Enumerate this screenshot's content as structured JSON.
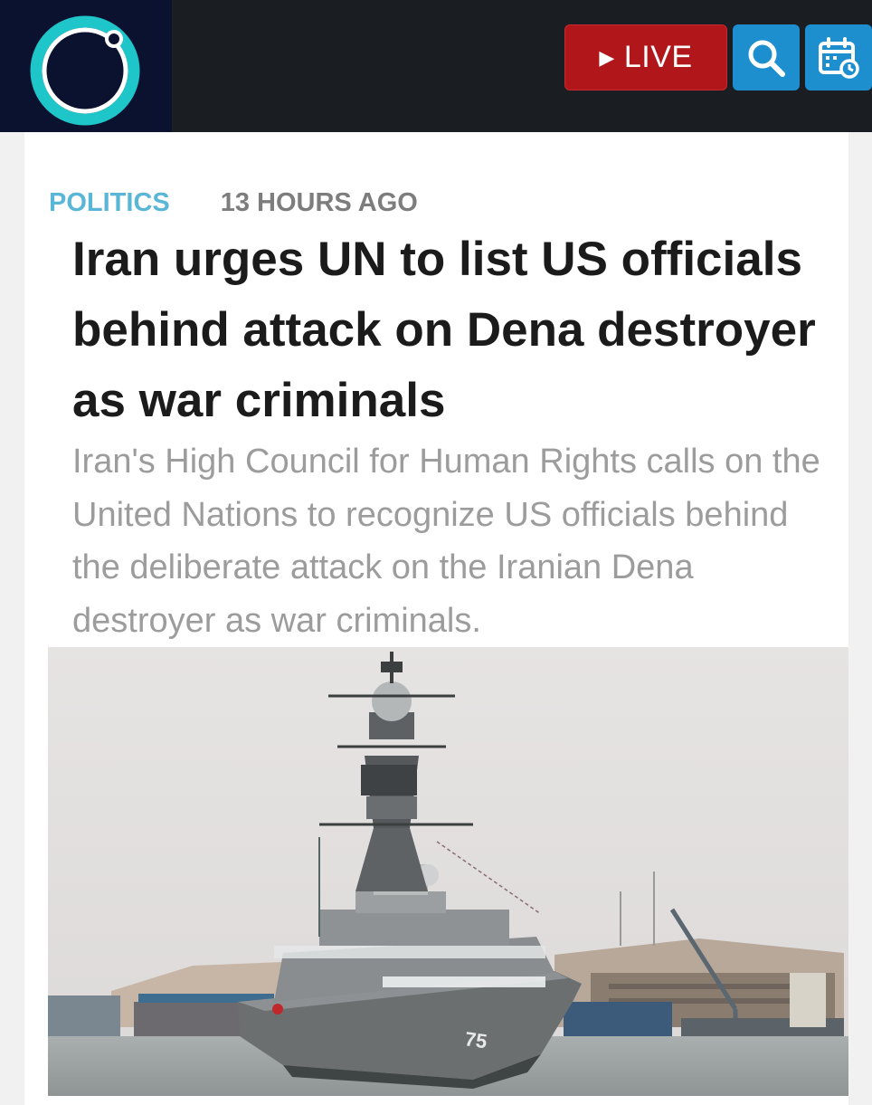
{
  "header": {
    "live_label": "LIVE",
    "icons": [
      "logo-icon",
      "play-icon",
      "search-icon",
      "calendar-icon"
    ],
    "colors": {
      "live": "#b1161b",
      "icon_button": "#1d8fcf",
      "logo_ring": "#1ec6c9",
      "bar": "#1a1d22"
    }
  },
  "article": {
    "category": "POLITICS",
    "time": "13 HOURS AGO",
    "headline": "Iran urges UN to list US officials behind attack on Dena destroyer as war criminals",
    "summary": "Iran's High Council for Human Rights calls on the United Nations to recognize US officials behind the deliberate attack on the Iranian Dena destroyer as war criminals.",
    "image": {
      "hull_number": "75"
    }
  }
}
